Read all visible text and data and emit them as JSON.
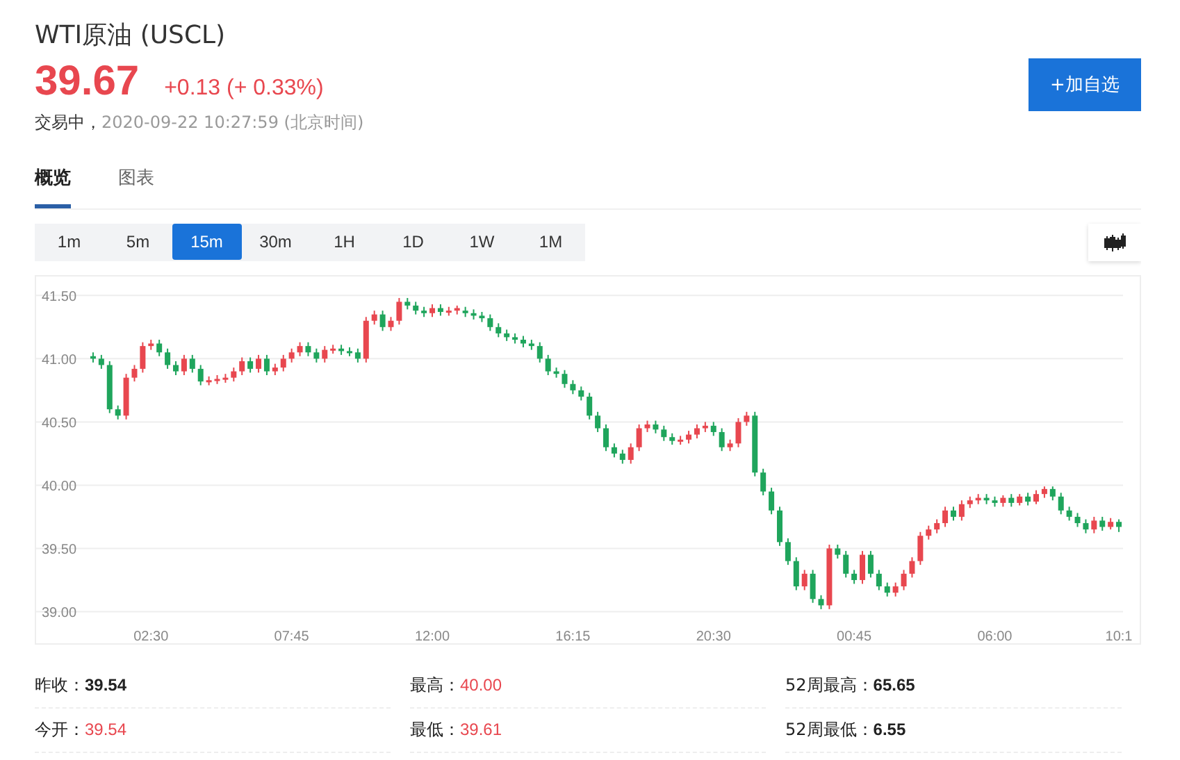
{
  "title": "WTI原油 (USCL)",
  "quote": {
    "price": "39.67",
    "change": "+0.13 (+ 0.33%)",
    "status": "交易中，",
    "time": "2020-09-22 10:27:59 (北京时间)"
  },
  "watch_button": "+加自选",
  "tabs": [
    {
      "label": "概览",
      "selected": true
    },
    {
      "label": "图表",
      "selected": false
    }
  ],
  "intervals": [
    {
      "label": "1m",
      "selected": false
    },
    {
      "label": "5m",
      "selected": false
    },
    {
      "label": "15m",
      "selected": true
    },
    {
      "label": "30m",
      "selected": false
    },
    {
      "label": "1H",
      "selected": false
    },
    {
      "label": "1D",
      "selected": false
    },
    {
      "label": "1W",
      "selected": false
    },
    {
      "label": "1M",
      "selected": false
    }
  ],
  "chart": {
    "chart_data": {
      "type": "candlestick",
      "ylim": [
        38.75,
        41.65
      ],
      "grid": true,
      "categories": [
        null,
        null,
        null,
        null,
        null,
        null,
        null,
        "02:30",
        null,
        null,
        null,
        null,
        null,
        null,
        null,
        null,
        null,
        null,
        null,
        null,
        null,
        null,
        null,
        null,
        "07:45",
        null,
        null,
        null,
        null,
        null,
        null,
        null,
        null,
        null,
        null,
        null,
        null,
        null,
        null,
        null,
        null,
        "12:00",
        null,
        null,
        null,
        null,
        null,
        null,
        null,
        null,
        null,
        null,
        null,
        null,
        null,
        null,
        null,
        null,
        "16:15",
        null,
        null,
        null,
        null,
        null,
        null,
        null,
        null,
        null,
        null,
        null,
        null,
        null,
        null,
        null,
        null,
        "20:30",
        null,
        null,
        null,
        null,
        null,
        null,
        null,
        null,
        null,
        null,
        null,
        null,
        null,
        null,
        null,
        null,
        "00:45",
        null,
        null,
        null,
        null,
        null,
        null,
        null,
        null,
        null,
        null,
        null,
        null,
        null,
        null,
        null,
        null,
        "06:00",
        null,
        null,
        null,
        null,
        null,
        null,
        null,
        null,
        null,
        null,
        null,
        null,
        null,
        null,
        "10:1"
      ],
      "yticks": [
        {
          "value": 39.0,
          "label": "39.00"
        },
        {
          "value": 39.5,
          "label": "39.50"
        },
        {
          "value": 40.0,
          "label": "40.00"
        },
        {
          "value": 40.5,
          "label": "40.50"
        },
        {
          "value": 41.0,
          "label": "41.00"
        },
        {
          "value": 41.5,
          "label": "41.50"
        }
      ],
      "ohlc": [
        [
          41.02,
          41.05,
          40.97,
          41.0
        ],
        [
          41.0,
          41.03,
          40.92,
          40.95
        ],
        [
          40.95,
          40.98,
          40.57,
          40.6
        ],
        [
          40.6,
          40.63,
          40.52,
          40.55
        ],
        [
          40.55,
          40.88,
          40.52,
          40.85
        ],
        [
          40.85,
          40.95,
          40.82,
          40.92
        ],
        [
          40.92,
          41.13,
          40.89,
          41.1
        ],
        [
          41.1,
          41.15,
          41.07,
          41.12
        ],
        [
          41.12,
          41.15,
          41.02,
          41.05
        ],
        [
          41.05,
          41.08,
          40.92,
          40.95
        ],
        [
          40.95,
          40.98,
          40.87,
          40.9
        ],
        [
          40.9,
          41.03,
          40.87,
          41.0
        ],
        [
          41.0,
          41.03,
          40.89,
          40.92
        ],
        [
          40.92,
          40.95,
          40.79,
          40.82
        ],
        [
          40.82,
          40.86,
          40.79,
          40.83
        ],
        [
          40.83,
          40.87,
          40.8,
          40.84
        ],
        [
          40.84,
          40.88,
          40.81,
          40.85
        ],
        [
          40.85,
          40.93,
          40.82,
          40.9
        ],
        [
          40.9,
          41.01,
          40.87,
          40.98
        ],
        [
          40.98,
          41.01,
          40.89,
          40.92
        ],
        [
          40.92,
          41.03,
          40.89,
          41.0
        ],
        [
          41.0,
          41.03,
          40.87,
          40.9
        ],
        [
          40.9,
          40.96,
          40.87,
          40.93
        ],
        [
          40.93,
          41.03,
          40.9,
          41.0
        ],
        [
          41.0,
          41.08,
          40.97,
          41.05
        ],
        [
          41.05,
          41.13,
          41.02,
          41.1
        ],
        [
          41.1,
          41.13,
          41.02,
          41.05
        ],
        [
          41.05,
          41.08,
          40.97,
          41.0
        ],
        [
          41.0,
          41.1,
          40.97,
          41.07
        ],
        [
          41.07,
          41.11,
          41.04,
          41.08
        ],
        [
          41.08,
          41.11,
          41.03,
          41.06
        ],
        [
          41.06,
          41.09,
          41.02,
          41.05
        ],
        [
          41.05,
          41.08,
          40.97,
          41.0
        ],
        [
          41.0,
          41.33,
          40.97,
          41.3
        ],
        [
          41.3,
          41.38,
          41.27,
          41.35
        ],
        [
          41.35,
          41.38,
          41.22,
          41.25
        ],
        [
          41.25,
          41.33,
          41.22,
          41.3
        ],
        [
          41.3,
          41.48,
          41.27,
          41.45
        ],
        [
          41.45,
          41.48,
          41.39,
          41.42
        ],
        [
          41.42,
          41.45,
          41.35,
          41.38
        ],
        [
          41.38,
          41.41,
          41.33,
          41.36
        ],
        [
          41.36,
          41.43,
          41.33,
          41.4
        ],
        [
          41.4,
          41.43,
          41.34,
          41.37
        ],
        [
          41.37,
          41.41,
          41.34,
          41.38
        ],
        [
          41.38,
          41.42,
          41.35,
          41.4
        ],
        [
          41.38,
          41.41,
          41.33,
          41.36
        ],
        [
          41.36,
          41.39,
          41.31,
          41.34
        ],
        [
          41.34,
          41.37,
          41.29,
          41.32
        ],
        [
          41.32,
          41.35,
          41.22,
          41.25
        ],
        [
          41.25,
          41.28,
          41.17,
          41.2
        ],
        [
          41.2,
          41.23,
          41.14,
          41.17
        ],
        [
          41.17,
          41.2,
          41.12,
          41.15
        ],
        [
          41.15,
          41.18,
          41.09,
          41.12
        ],
        [
          41.12,
          41.15,
          41.07,
          41.1
        ],
        [
          41.1,
          41.13,
          40.97,
          41.0
        ],
        [
          41.0,
          41.03,
          40.87,
          40.9
        ],
        [
          40.9,
          40.93,
          40.85,
          40.88
        ],
        [
          40.88,
          40.91,
          40.77,
          40.8
        ],
        [
          40.8,
          40.83,
          40.72,
          40.75
        ],
        [
          40.75,
          40.78,
          40.67,
          40.7
        ],
        [
          40.7,
          40.73,
          40.52,
          40.55
        ],
        [
          40.55,
          40.58,
          40.42,
          40.45
        ],
        [
          40.45,
          40.48,
          40.27,
          40.3
        ],
        [
          40.3,
          40.33,
          40.22,
          40.25
        ],
        [
          40.25,
          40.28,
          40.17,
          40.2
        ],
        [
          40.2,
          40.33,
          40.17,
          40.3
        ],
        [
          40.3,
          40.48,
          40.27,
          40.45
        ],
        [
          40.45,
          40.51,
          40.42,
          40.48
        ],
        [
          40.48,
          40.51,
          40.41,
          40.44
        ],
        [
          40.44,
          40.47,
          40.35,
          40.38
        ],
        [
          40.38,
          40.41,
          40.32,
          40.35
        ],
        [
          40.35,
          40.39,
          40.32,
          40.36
        ],
        [
          40.36,
          40.43,
          40.33,
          40.4
        ],
        [
          40.4,
          40.48,
          40.37,
          40.45
        ],
        [
          40.45,
          40.5,
          40.42,
          40.47
        ],
        [
          40.47,
          40.5,
          40.39,
          40.42
        ],
        [
          40.42,
          40.45,
          40.27,
          40.3
        ],
        [
          40.3,
          40.36,
          40.27,
          40.33
        ],
        [
          40.33,
          40.53,
          40.3,
          40.5
        ],
        [
          40.5,
          40.58,
          40.47,
          40.55
        ],
        [
          40.55,
          40.58,
          40.07,
          40.1
        ],
        [
          40.1,
          40.13,
          39.92,
          39.95
        ],
        [
          39.95,
          39.98,
          39.77,
          39.8
        ],
        [
          39.8,
          39.83,
          39.52,
          39.55
        ],
        [
          39.55,
          39.58,
          39.37,
          39.4
        ],
        [
          39.4,
          39.43,
          39.17,
          39.2
        ],
        [
          39.2,
          39.33,
          39.17,
          39.3
        ],
        [
          39.3,
          39.33,
          39.07,
          39.1
        ],
        [
          39.1,
          39.13,
          39.02,
          39.05
        ],
        [
          39.05,
          39.53,
          39.02,
          39.5
        ],
        [
          39.5,
          39.53,
          39.42,
          39.45
        ],
        [
          39.45,
          39.48,
          39.27,
          39.3
        ],
        [
          39.3,
          39.33,
          39.22,
          39.25
        ],
        [
          39.25,
          39.48,
          39.22,
          39.45
        ],
        [
          39.45,
          39.48,
          39.27,
          39.3
        ],
        [
          39.3,
          39.33,
          39.17,
          39.2
        ],
        [
          39.2,
          39.23,
          39.12,
          39.15
        ],
        [
          39.15,
          39.23,
          39.12,
          39.2
        ],
        [
          39.2,
          39.33,
          39.17,
          39.3
        ],
        [
          39.3,
          39.43,
          39.27,
          39.4
        ],
        [
          39.4,
          39.63,
          39.37,
          39.6
        ],
        [
          39.6,
          39.68,
          39.57,
          39.65
        ],
        [
          39.65,
          39.73,
          39.62,
          39.7
        ],
        [
          39.7,
          39.83,
          39.67,
          39.8
        ],
        [
          39.8,
          39.83,
          39.72,
          39.75
        ],
        [
          39.75,
          39.88,
          39.72,
          39.85
        ],
        [
          39.85,
          39.91,
          39.82,
          39.88
        ],
        [
          39.88,
          39.93,
          39.85,
          39.9
        ],
        [
          39.9,
          39.93,
          39.85,
          39.88
        ],
        [
          39.88,
          39.91,
          39.83,
          39.86
        ],
        [
          39.86,
          39.92,
          39.83,
          39.9
        ],
        [
          39.9,
          39.93,
          39.83,
          39.86
        ],
        [
          39.86,
          39.93,
          39.84,
          39.91
        ],
        [
          39.91,
          39.94,
          39.84,
          39.87
        ],
        [
          39.87,
          39.96,
          39.85,
          39.93
        ],
        [
          39.93,
          39.99,
          39.9,
          39.97
        ],
        [
          39.97,
          39.99,
          39.88,
          39.91
        ],
        [
          39.91,
          39.94,
          39.77,
          39.8
        ],
        [
          39.8,
          39.83,
          39.72,
          39.75
        ],
        [
          39.75,
          39.78,
          39.67,
          39.7
        ],
        [
          39.7,
          39.73,
          39.62,
          39.65
        ],
        [
          39.65,
          39.75,
          39.62,
          39.72
        ],
        [
          39.72,
          39.75,
          39.64,
          39.67
        ],
        [
          39.67,
          39.74,
          39.65,
          39.71
        ],
        [
          39.71,
          39.73,
          39.63,
          39.67
        ]
      ]
    }
  },
  "stats": [
    {
      "label": "昨收：",
      "value": "39.54",
      "up": false
    },
    {
      "label": "最高：",
      "value": "40.00",
      "up": true
    },
    {
      "label": "52周最高：",
      "value": "65.65",
      "up": false
    },
    {
      "label": "今开：",
      "value": "39.54",
      "up": true
    },
    {
      "label": "最低：",
      "value": "39.61",
      "up": true
    },
    {
      "label": "52周最低：",
      "value": "6.55",
      "up": false
    }
  ]
}
